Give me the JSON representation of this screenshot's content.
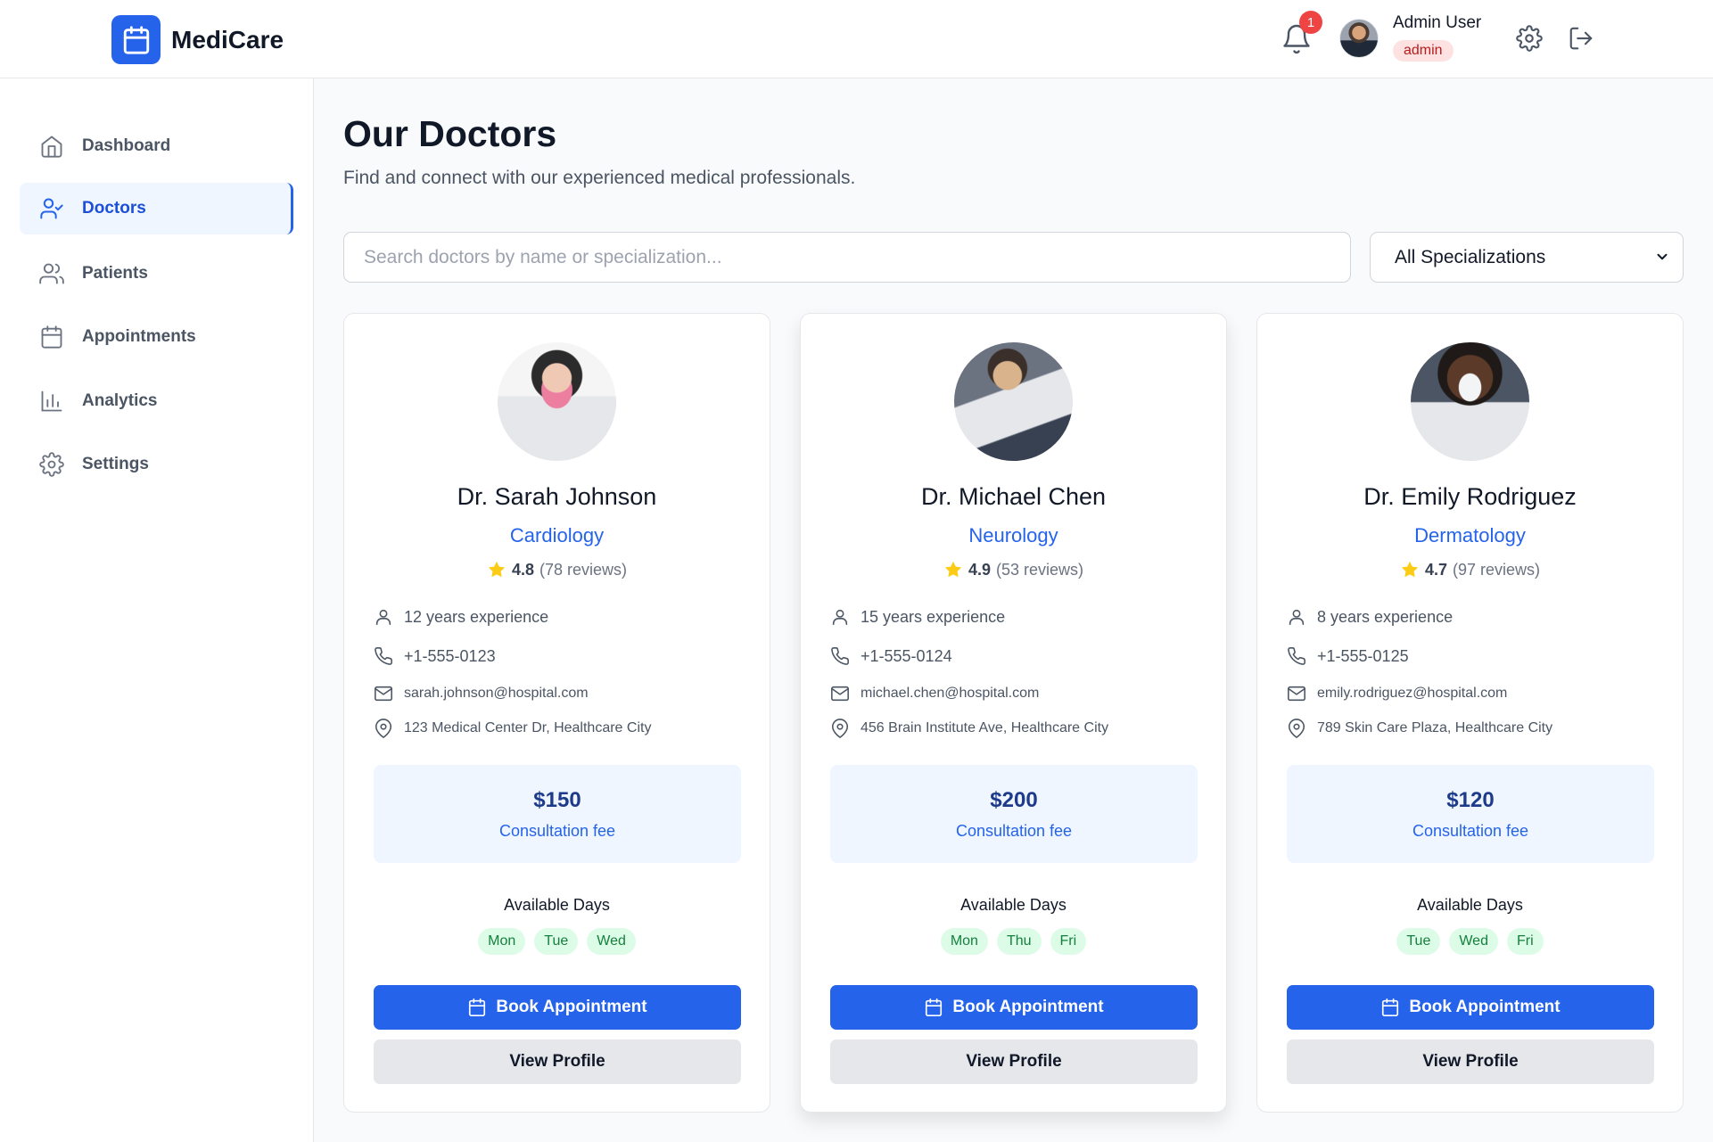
{
  "app": {
    "name": "MediCare"
  },
  "header": {
    "notification_count": "1",
    "user_name": "Admin User",
    "user_role": "admin"
  },
  "sidebar": {
    "items": [
      {
        "label": "Dashboard",
        "icon": "home-icon"
      },
      {
        "label": "Doctors",
        "icon": "user-check-icon",
        "active": true
      },
      {
        "label": "Patients",
        "icon": "users-icon"
      },
      {
        "label": "Appointments",
        "icon": "calendar-icon"
      },
      {
        "label": "Analytics",
        "icon": "bar-chart-icon"
      },
      {
        "label": "Settings",
        "icon": "gear-icon"
      }
    ]
  },
  "main": {
    "title": "Our Doctors",
    "subtitle": "Find and connect with our experienced medical professionals.",
    "search_placeholder": "Search doctors by name or specialization...",
    "filter_selected": "All Specializations"
  },
  "doctors": [
    {
      "name": "Dr. Sarah Johnson",
      "specialization": "Cardiology",
      "rating": "4.8",
      "reviews": "(78 reviews)",
      "experience": "12 years experience",
      "phone": "+1-555-0123",
      "email": "sarah.johnson@hospital.com",
      "address": "123 Medical Center Dr, Healthcare City",
      "fee": "$150",
      "fee_label": "Consultation fee",
      "days_title": "Available Days",
      "days": [
        "Mon",
        "Tue",
        "Wed"
      ],
      "book_label": "Book Appointment",
      "profile_label": "View Profile"
    },
    {
      "name": "Dr. Michael Chen",
      "specialization": "Neurology",
      "rating": "4.9",
      "reviews": "(53 reviews)",
      "experience": "15 years experience",
      "phone": "+1-555-0124",
      "email": "michael.chen@hospital.com",
      "address": "456 Brain Institute Ave, Healthcare City",
      "fee": "$200",
      "fee_label": "Consultation fee",
      "days_title": "Available Days",
      "days": [
        "Mon",
        "Thu",
        "Fri"
      ],
      "book_label": "Book Appointment",
      "profile_label": "View Profile"
    },
    {
      "name": "Dr. Emily Rodriguez",
      "specialization": "Dermatology",
      "rating": "4.7",
      "reviews": "(97 reviews)",
      "experience": "8 years experience",
      "phone": "+1-555-0125",
      "email": "emily.rodriguez@hospital.com",
      "address": "789 Skin Care Plaza, Healthcare City",
      "fee": "$120",
      "fee_label": "Consultation fee",
      "days_title": "Available Days",
      "days": [
        "Tue",
        "Wed",
        "Fri"
      ],
      "book_label": "Book Appointment",
      "profile_label": "View Profile"
    }
  ],
  "colors": {
    "accent": "#2563eb",
    "badge": "#ef4444",
    "available_day_bg": "#dcfce7",
    "fee_bg": "#eff6ff"
  }
}
